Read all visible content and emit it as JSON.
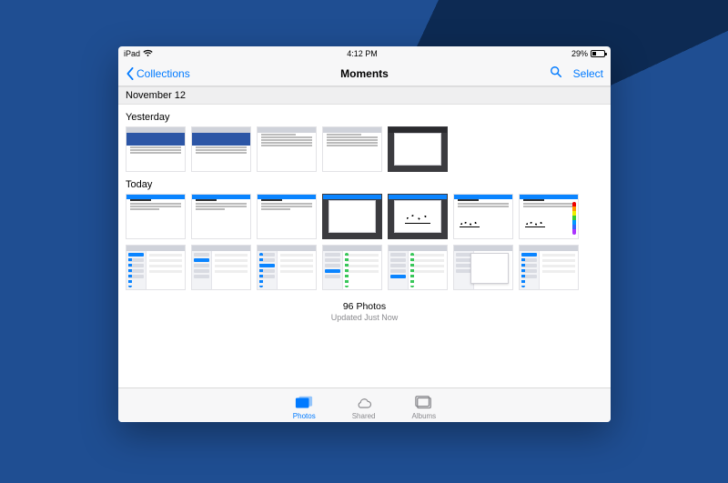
{
  "status": {
    "device": "iPad",
    "time": "4:12 PM",
    "battery_pct": "29%"
  },
  "nav": {
    "back_label": "Collections",
    "title": "Moments",
    "select_label": "Select"
  },
  "section_date": "November 12",
  "groups": {
    "yesterday_label": "Yesterday",
    "today_label": "Today"
  },
  "summary": {
    "count_line": "96 Photos",
    "updated_line": "Updated Just Now"
  },
  "tabs": {
    "photos": "Photos",
    "shared": "Shared",
    "albums": "Albums"
  }
}
